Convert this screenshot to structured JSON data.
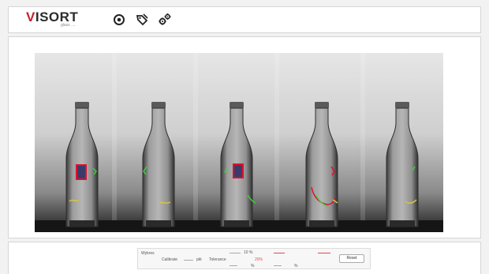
{
  "app": {
    "logo_main": "ISORT",
    "logo_accent": "V",
    "logo_sub": "glass ...."
  },
  "toolbar": {
    "icons": [
      "eye-icon",
      "tag-icon",
      "gears-icon"
    ]
  },
  "settings": {
    "title": "Wykres",
    "calibrate_label": "Calibrate",
    "fields": [
      {
        "label": "Tolerance",
        "value": "pkt"
      },
      {
        "label": "",
        "value": "10 %"
      },
      {
        "label": "",
        "value": "20%"
      },
      {
        "label": "",
        "value": "%"
      },
      {
        "label": "",
        "value": "%"
      }
    ],
    "reset_label": "Reset"
  },
  "colors": {
    "accent": "#c8202a",
    "defect_marker": "#e0102a",
    "green_mark": "#3ccf3c"
  }
}
